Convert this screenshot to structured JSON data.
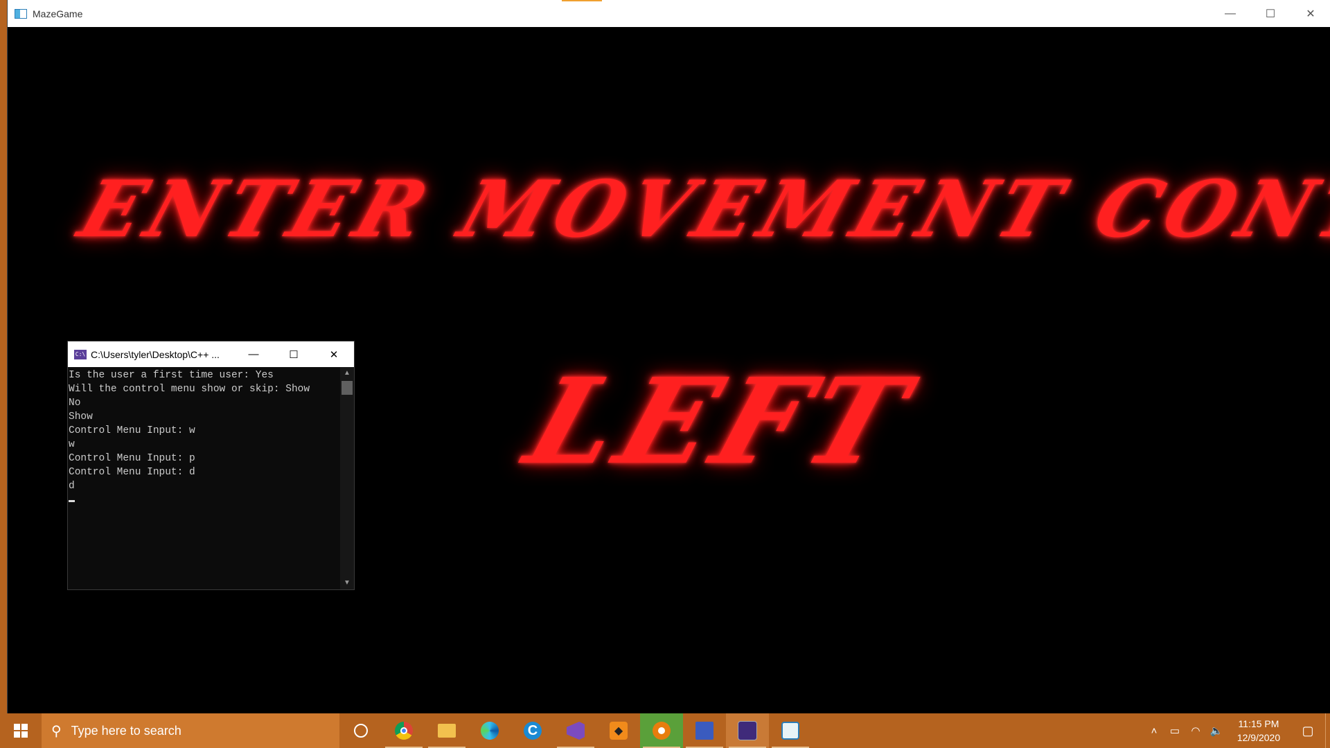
{
  "game_window": {
    "title": "MazeGame",
    "headline": "ENTER MOVEMENT CONTROLS",
    "direction": "LEFT"
  },
  "window_controls": {
    "minimize": "—",
    "maximize": "☐",
    "close": "✕"
  },
  "console": {
    "title": "C:\\Users\\tyler\\Desktop\\C++ ...",
    "icon_label": "C:\\",
    "lines": [
      "Is the user a first time user: Yes",
      "Will the control menu show or skip: Show",
      "No",
      "Show",
      "Control Menu Input: w",
      "w",
      "Control Menu Input: p",
      "Control Menu Input: d",
      "d"
    ]
  },
  "taskbar": {
    "search_placeholder": "Type here to search",
    "apps": [
      {
        "name": "cortana-icon"
      },
      {
        "name": "chrome-icon"
      },
      {
        "name": "file-explorer-icon"
      },
      {
        "name": "edge-icon"
      },
      {
        "name": "ccleaner-icon"
      },
      {
        "name": "visual-studio-icon"
      },
      {
        "name": "sublime-icon"
      },
      {
        "name": "blender-icon"
      },
      {
        "name": "network-icon"
      },
      {
        "name": "command-prompt-icon"
      },
      {
        "name": "mazegame-icon"
      }
    ],
    "clock_time": "11:15 PM",
    "clock_date": "12/9/2020"
  },
  "colors": {
    "taskbar": "#b5631f",
    "title_text": "#ff2020",
    "console_bg": "#0c0c0c"
  }
}
